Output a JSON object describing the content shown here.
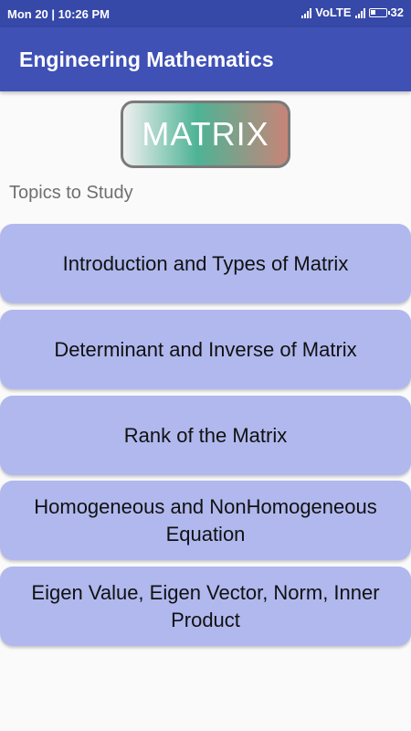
{
  "status_bar": {
    "time": "Mon 20 | 10:26 PM",
    "network": "VoLTE",
    "battery_level": "32",
    "icons": [
      "signal-icon",
      "volte-label",
      "signal-icon",
      "battery-icon"
    ]
  },
  "app_bar": {
    "title": "Engineering Mathematics",
    "color": "#3f51b5"
  },
  "header_badge": {
    "label": "MATRIX"
  },
  "section": {
    "label": "Topics to Study"
  },
  "topics": [
    {
      "label": "Introduction and Types of Matrix"
    },
    {
      "label": "Determinant and Inverse of Matrix"
    },
    {
      "label": "Rank of the Matrix"
    },
    {
      "label": "Homogeneous and NonHomogeneous Equation"
    },
    {
      "label": "Eigen Value, Eigen Vector, Norm, Inner Product"
    }
  ],
  "colors": {
    "status_bar": "#3648a8",
    "button_bg": "#b0b8ee",
    "background": "#fafafa"
  }
}
